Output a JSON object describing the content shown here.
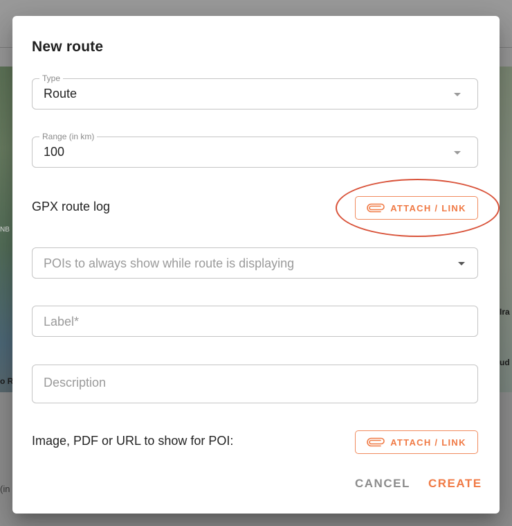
{
  "background": {
    "left_fragment_1": "NB",
    "left_fragment_2": "o R",
    "left_fragment_3": "(in",
    "right_fragment_1": "Ira",
    "right_fragment_2": "ud"
  },
  "dialog": {
    "title": "New route",
    "type_field": {
      "label": "Type",
      "value": "Route"
    },
    "range_field": {
      "label": "Range (in km)",
      "value": "100"
    },
    "gpx": {
      "label": "GPX route log",
      "button_label": "ATTACH / LINK",
      "button_icon": "paperclip-icon"
    },
    "pois_field": {
      "placeholder": "POIs to always show while route is displaying"
    },
    "label_field": {
      "placeholder": "Label*"
    },
    "description_field": {
      "placeholder": "Description"
    },
    "media": {
      "label": "Image, PDF or URL to show for POI:",
      "button_label": "ATTACH / LINK",
      "button_icon": "paperclip-icon"
    },
    "actions": {
      "cancel_label": "CANCEL",
      "create_label": "CREATE"
    }
  },
  "colors": {
    "accent": "#f07a45",
    "highlight_ring": "#d9533a",
    "border": "#c4c4c4"
  }
}
